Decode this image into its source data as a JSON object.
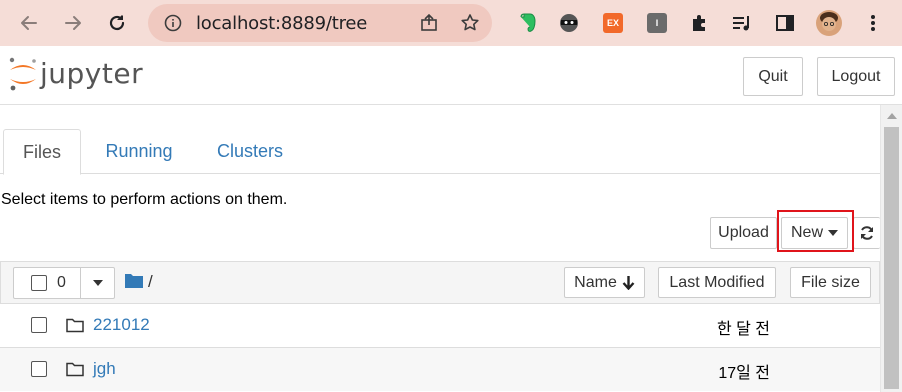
{
  "browser": {
    "url": "localhost:8889/tree",
    "nav": [
      "back-icon",
      "forward-icon",
      "reload-icon"
    ],
    "extensions": [
      {
        "name": "evernote-icon",
        "color": "#2dbe60"
      },
      {
        "name": "ninja-icon",
        "color": "#444444"
      },
      {
        "name": "ex-extension-icon",
        "label": "EX",
        "color": "#f2692a"
      },
      {
        "name": "i-extension-icon",
        "label": "I",
        "color": "#5f6368"
      },
      {
        "name": "puzzle-icon",
        "color": "#202124"
      },
      {
        "name": "media-playlist-icon",
        "color": "#202124"
      },
      {
        "name": "side-panel-icon",
        "color": "#202124"
      },
      {
        "name": "profile-avatar",
        "color": "#b06a3b"
      },
      {
        "name": "more-vert-icon",
        "color": "#202124"
      }
    ]
  },
  "header": {
    "logo": "jupyter",
    "quit_label": "Quit",
    "logout_label": "Logout"
  },
  "tabs": [
    {
      "label": "Files",
      "active": true
    },
    {
      "label": "Running",
      "active": false
    },
    {
      "label": "Clusters",
      "active": false
    }
  ],
  "hint": "Select items to perform actions on them.",
  "toolbar": {
    "upload_label": "Upload",
    "new_label": "New",
    "refresh_icon": "refresh-icon"
  },
  "list": {
    "selected_count": "0",
    "breadcrumb": "/",
    "columns": {
      "name": "Name",
      "last_modified": "Last Modified",
      "file_size": "File size"
    },
    "rows": [
      {
        "name": "221012",
        "modified": "한 달 전"
      },
      {
        "name": "jgh",
        "modified": "17일 전"
      }
    ]
  },
  "colors": {
    "link": "#337ab7",
    "highlight": "#e0141b",
    "jupyter_orange": "#f37726"
  }
}
